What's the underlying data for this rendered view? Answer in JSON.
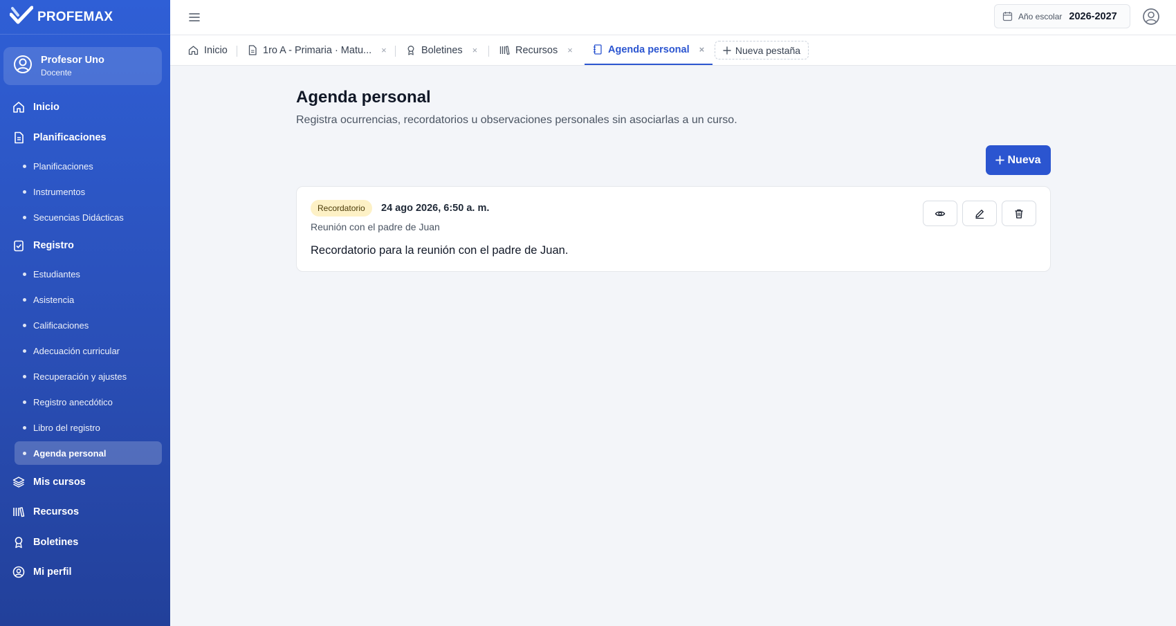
{
  "app": {
    "brand": "PROFEMAX"
  },
  "user": {
    "name": "Profesor Uno",
    "role": "Docente"
  },
  "sidebar": {
    "inicio": "Inicio",
    "planificaciones": "Planificaciones",
    "planificaciones_items": [
      "Planificaciones",
      "Instrumentos",
      "Secuencias Didácticas"
    ],
    "registro": "Registro",
    "registro_items": [
      "Estudiantes",
      "Asistencia",
      "Calificaciones",
      "Adecuación curricular",
      "Recuperación y ajustes",
      "Registro anecdótico",
      "Libro del registro",
      "Agenda personal"
    ],
    "mis_cursos": "Mis cursos",
    "recursos": "Recursos",
    "boletines": "Boletines",
    "mi_perfil": "Mi perfil"
  },
  "topbar": {
    "year_label": "Año escolar",
    "year_value": "2026-2027"
  },
  "tabs": {
    "items": [
      "Inicio",
      "1ro A - Primaria · Matu...",
      "Boletines",
      "Recursos",
      "Agenda personal"
    ],
    "close": "×",
    "new_tab": "Nueva pestaña"
  },
  "main": {
    "title": "Agenda personal",
    "subtitle": "Registra ocurrencias, recordatorios u observaciones personales sin asociarlas a un curso.",
    "new_button": "Nueva"
  },
  "entry": {
    "badge": "Recordatorio",
    "date": "24 ago 2026, 6:50 a. m.",
    "title": "Reunión con el padre de Juan",
    "body": "Recordatorio para la reunión con el padre de Juan."
  },
  "colors": {
    "primary": "#2b55d0",
    "sidebar_top": "#2f5fd6",
    "sidebar_bottom": "#22409a",
    "badge_bg": "#fdf1c6"
  }
}
